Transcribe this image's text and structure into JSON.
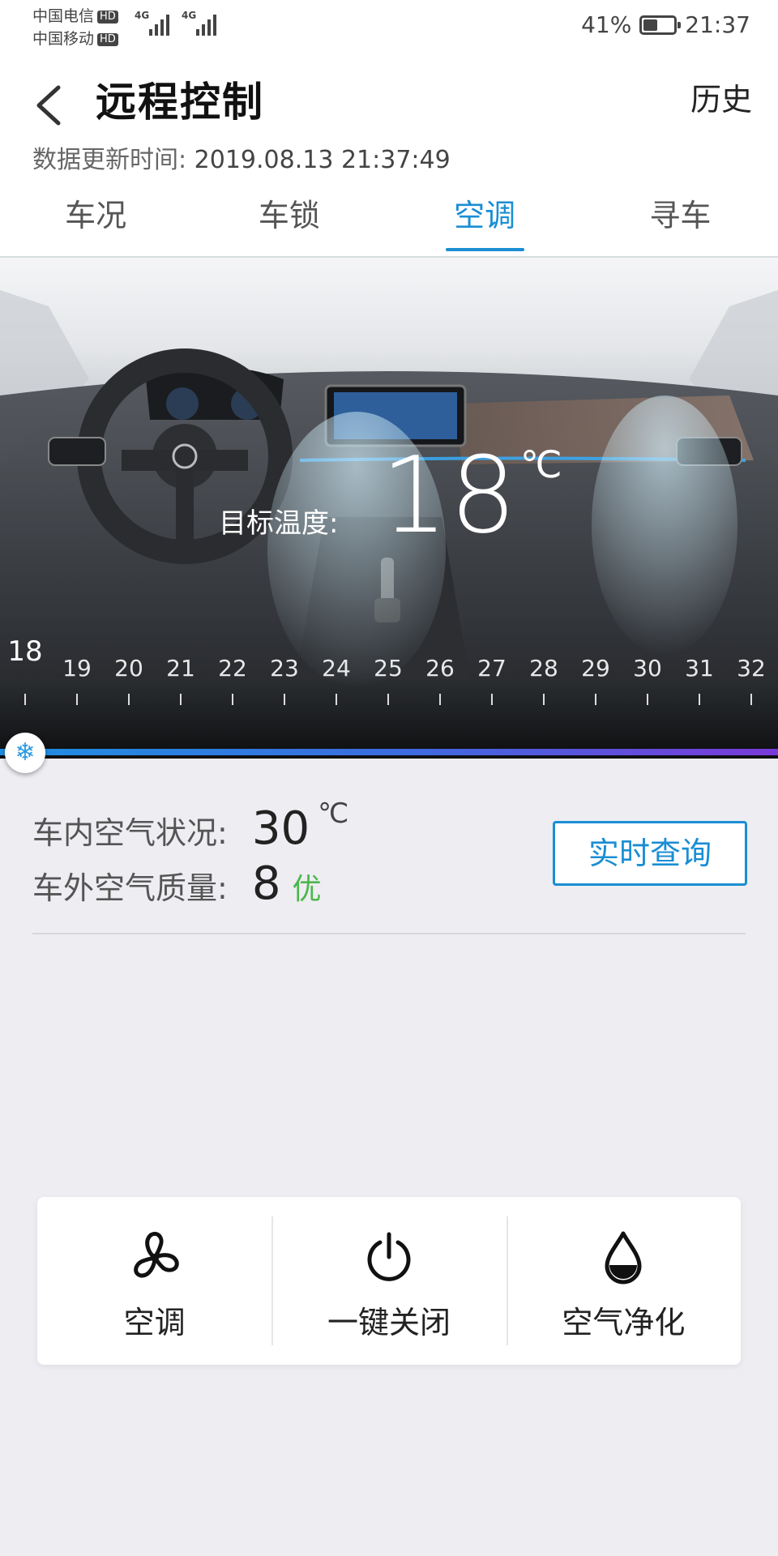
{
  "status_bar": {
    "carrier1": "中国电信",
    "carrier2": "中国移动",
    "hd": "HD",
    "net1": "4G",
    "net2": "4G",
    "battery_percent": "41%",
    "battery_level": 0.41,
    "time": "21:37"
  },
  "header": {
    "title": "远程控制",
    "history_label": "历史",
    "update_label": "数据更新时间:",
    "update_time": "2019.08.13 21:37:49",
    "back_icon": "chevron-left-icon"
  },
  "tabs": [
    {
      "label": "车况",
      "active": false
    },
    {
      "label": "车锁",
      "active": false
    },
    {
      "label": "空调",
      "active": true
    },
    {
      "label": "寻车",
      "active": false
    }
  ],
  "climate": {
    "target_label": "目标温度:",
    "target_temp": "18",
    "unit": "℃",
    "scale": [
      "18",
      "19",
      "20",
      "21",
      "22",
      "23",
      "24",
      "25",
      "26",
      "27",
      "28",
      "29",
      "30",
      "31",
      "32"
    ],
    "selected_temp": "18",
    "slider_icon": "snowflake-icon",
    "accent_color": "#1a8ed4"
  },
  "air": {
    "inside_label": "车内空气状况:",
    "inside_value": "30",
    "inside_unit": "℃",
    "outside_label": "车外空气质量:",
    "outside_value": "8",
    "outside_quality": "优",
    "quality_color": "#4cb64c",
    "query_button": "实时查询"
  },
  "actions": [
    {
      "label": "空调",
      "icon": "fan-icon"
    },
    {
      "label": "一键关闭",
      "icon": "power-icon"
    },
    {
      "label": "空气净化",
      "icon": "water-drop-icon"
    }
  ]
}
